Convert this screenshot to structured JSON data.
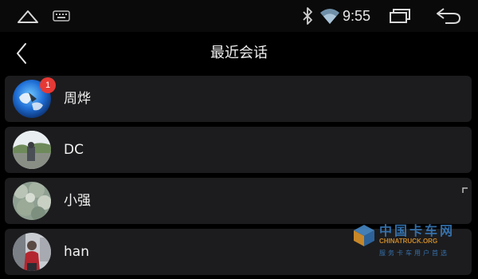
{
  "status_bar": {
    "time": "9:55",
    "icons": [
      "home-icon",
      "keyboard-icon",
      "bluetooth-icon",
      "wifi-icon",
      "recent-apps-icon",
      "back-icon"
    ]
  },
  "header": {
    "title": "最近会话",
    "back_icon": "chevron-left-icon"
  },
  "conversations": [
    {
      "name": "周烨",
      "unread": "1",
      "avatar": "globe-avatar"
    },
    {
      "name": "DC",
      "unread": "",
      "avatar": "landscape-avatar"
    },
    {
      "name": "小强",
      "unread": "",
      "avatar": "foliage-avatar"
    },
    {
      "name": "han",
      "unread": "",
      "avatar": "person-avatar"
    }
  ],
  "watermark": {
    "name": "中国卡车网",
    "domain": "CHINATRUCK.ORG",
    "slogan": "服务卡车用户首选"
  },
  "colors": {
    "background": "#000000",
    "list_item": "#1c1c1e",
    "badge": "#e53935",
    "text": "#f2f2f2"
  }
}
